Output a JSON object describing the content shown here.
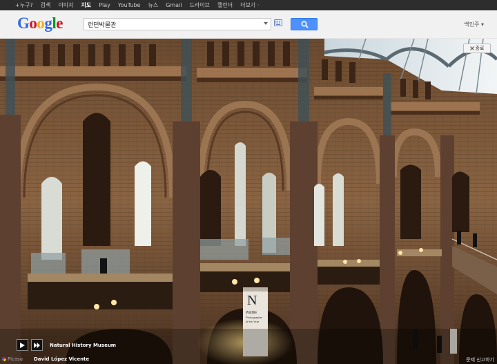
{
  "topbar": {
    "items": [
      "+누구?",
      "검색",
      "이미지",
      "지도",
      "Play",
      "YouTube",
      "뉴스",
      "Gmail",
      "드라이브",
      "캘린더",
      "더보기 ·"
    ],
    "active_index": 3
  },
  "header": {
    "logo_letters": [
      {
        "ch": "G",
        "color": "#3369e8"
      },
      {
        "ch": "o",
        "color": "#d50f25"
      },
      {
        "ch": "o",
        "color": "#eeb211"
      },
      {
        "ch": "g",
        "color": "#3369e8"
      },
      {
        "ch": "l",
        "color": "#009925"
      },
      {
        "ch": "e",
        "color": "#d50f25"
      }
    ],
    "search_value": "런던박물관",
    "search_button_icon": "magnifier-icon",
    "keyboard_icon": "keyboard-icon",
    "user_label": "백인주 ▾"
  },
  "photo": {
    "close_label": "종료",
    "caption_title": "Natural History Museum",
    "author": "David López Vicente",
    "picasa_label": "Picasa",
    "report_label": "문제 신고하기",
    "banner_letter": "N",
    "banner_text": "Wildlife Photographer of the Year",
    "play_icon": "play-icon",
    "next_icon": "next-icon"
  }
}
